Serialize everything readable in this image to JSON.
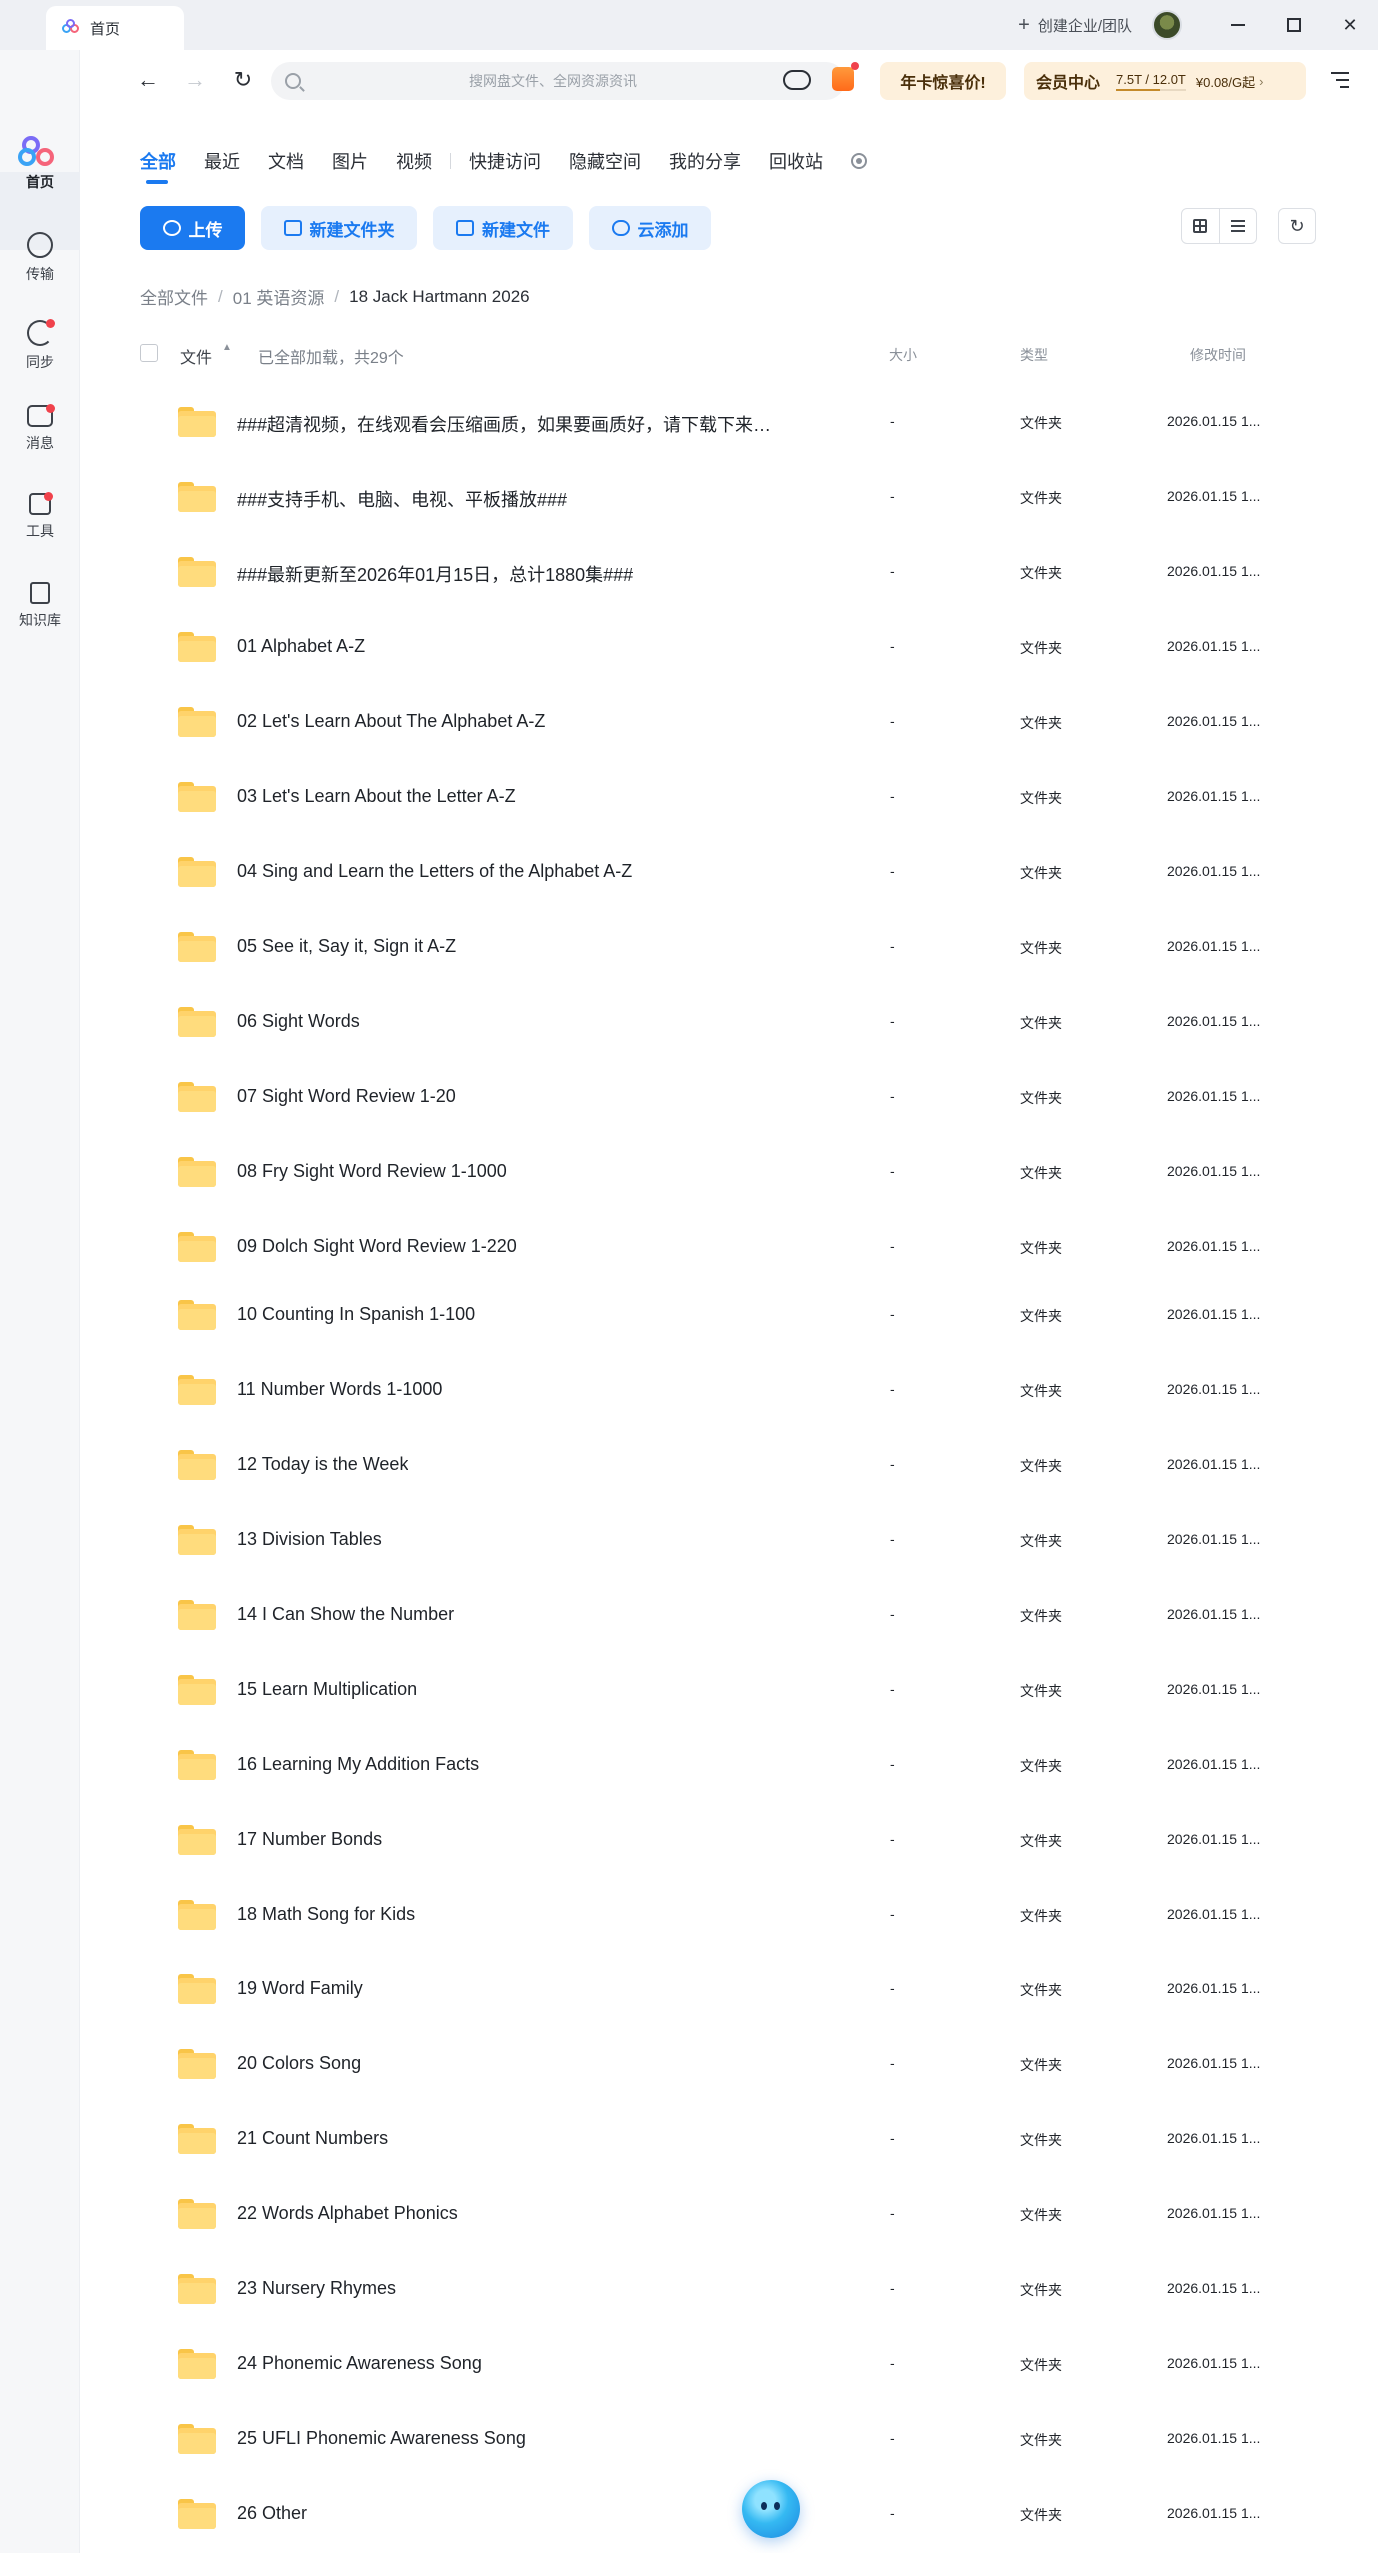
{
  "window": {
    "tab_title": "首页",
    "create_team": "创建企业/团队"
  },
  "rail": {
    "home": "首页",
    "transfer": "传输",
    "sync": "同步",
    "messages": "消息",
    "tools": "工具",
    "knowledge": "知识库"
  },
  "toolbar": {
    "search_placeholder": "搜网盘文件、全网资源资讯",
    "promo_label": "年卡惊喜价!",
    "vip_title": "会员中心",
    "quota": "7.5T / 12.0T",
    "quota_used_fraction": 0.625,
    "price": "¥0.08/G起"
  },
  "categories": [
    "全部",
    "最近",
    "文档",
    "图片",
    "视频",
    "快捷访问",
    "隐藏空间",
    "我的分享",
    "回收站"
  ],
  "actions": {
    "upload": "上传",
    "new_folder": "新建文件夹",
    "new_file": "新建文件",
    "cloud_add": "云添加"
  },
  "breadcrumb": [
    "全部文件",
    "01 英语资源",
    "18 Jack Hartmann 2026"
  ],
  "table": {
    "name_header": "文件",
    "loaded_status": "已全部加载，共29个",
    "size_header": "大小",
    "type_header": "类型",
    "time_header": "修改时间",
    "rows": [
      {
        "name": "###超清视频，在线观看会压缩画质，如果要画质好，请下载下来观...",
        "size": "-",
        "type": "文件夹",
        "time": "2026.01.15 1..."
      },
      {
        "name": "###支持手机、电脑、电视、平板播放###",
        "size": "-",
        "type": "文件夹",
        "time": "2026.01.15 1..."
      },
      {
        "name": "###最新更新至2026年01月15日，总计1880集###",
        "size": "-",
        "type": "文件夹",
        "time": "2026.01.15 1..."
      },
      {
        "name": "01 Alphabet A-Z",
        "size": "-",
        "type": "文件夹",
        "time": "2026.01.15 1..."
      },
      {
        "name": "02 Let's Learn About The Alphabet A-Z",
        "size": "-",
        "type": "文件夹",
        "time": "2026.01.15 1..."
      },
      {
        "name": "03 Let's Learn About the Letter A-Z",
        "size": "-",
        "type": "文件夹",
        "time": "2026.01.15 1..."
      },
      {
        "name": "04 Sing and Learn the Letters of the Alphabet A-Z",
        "size": "-",
        "type": "文件夹",
        "time": "2026.01.15 1..."
      },
      {
        "name": "05 See it, Say it, Sign it A-Z",
        "size": "-",
        "type": "文件夹",
        "time": "2026.01.15 1..."
      },
      {
        "name": "06 Sight Words",
        "size": "-",
        "type": "文件夹",
        "time": "2026.01.15 1..."
      },
      {
        "name": "07 Sight Word Review 1-20",
        "size": "-",
        "type": "文件夹",
        "time": "2026.01.15 1..."
      },
      {
        "name": "08 Fry Sight Word Review 1-1000",
        "size": "-",
        "type": "文件夹",
        "time": "2026.01.15 1..."
      },
      {
        "name": "09 Dolch Sight Word Review 1-220",
        "size": "-",
        "type": "文件夹",
        "time": "2026.01.15 1..."
      },
      {
        "name": "10 Counting In Spanish 1-100",
        "size": "-",
        "type": "文件夹",
        "time": "2026.01.15 1..."
      },
      {
        "name": "11 Number Words 1-1000",
        "size": "-",
        "type": "文件夹",
        "time": "2026.01.15 1..."
      },
      {
        "name": "12 Today is the Week",
        "size": "-",
        "type": "文件夹",
        "time": "2026.01.15 1..."
      },
      {
        "name": "13 Division Tables",
        "size": "-",
        "type": "文件夹",
        "time": "2026.01.15 1..."
      },
      {
        "name": "14 I Can Show the Number",
        "size": "-",
        "type": "文件夹",
        "time": "2026.01.15 1..."
      },
      {
        "name": "15 Learn Multiplication",
        "size": "-",
        "type": "文件夹",
        "time": "2026.01.15 1..."
      },
      {
        "name": "16 Learning My Addition Facts",
        "size": "-",
        "type": "文件夹",
        "time": "2026.01.15 1..."
      },
      {
        "name": "17 Number Bonds",
        "size": "-",
        "type": "文件夹",
        "time": "2026.01.15 1..."
      },
      {
        "name": "18 Math Song for Kids",
        "size": "-",
        "type": "文件夹",
        "time": "2026.01.15 1..."
      },
      {
        "name": "19 Word Family",
        "size": "-",
        "type": "文件夹",
        "time": "2026.01.15 1..."
      },
      {
        "name": "20 Colors Song",
        "size": "-",
        "type": "文件夹",
        "time": "2026.01.15 1..."
      },
      {
        "name": "21 Count Numbers",
        "size": "-",
        "type": "文件夹",
        "time": "2026.01.15 1..."
      },
      {
        "name": "22 Words Alphabet Phonics",
        "size": "-",
        "type": "文件夹",
        "time": "2026.01.15 1..."
      },
      {
        "name": "23 Nursery Rhymes",
        "size": "-",
        "type": "文件夹",
        "time": "2026.01.15 1..."
      },
      {
        "name": "24 Phonemic Awareness Song",
        "size": "-",
        "type": "文件夹",
        "time": "2026.01.15 1..."
      },
      {
        "name": "25 UFLI Phonemic Awareness Song",
        "size": "-",
        "type": "文件夹",
        "time": "2026.01.15 1..."
      },
      {
        "name": "26 Other",
        "size": "-",
        "type": "文件夹",
        "time": "2026.01.15 1..."
      }
    ]
  },
  "colors": {
    "accent": "#1b7af0",
    "folder": "#ffd36b",
    "badge": "#f0424c",
    "promo_bg": "#fdf0dc"
  }
}
